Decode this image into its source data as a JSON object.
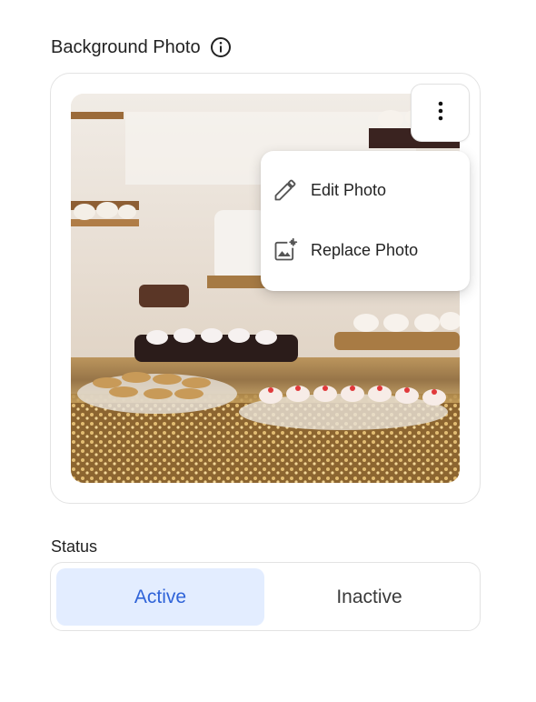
{
  "background_photo": {
    "title": "Background Photo",
    "info_icon": "info-circle-icon",
    "more_icon": "vertical-dots-icon",
    "image_description": "dessert table with cakes, cupcakes and cookies",
    "menu": {
      "items": [
        {
          "label": "Edit Photo",
          "icon": "pencil-icon"
        },
        {
          "label": "Replace Photo",
          "icon": "image-add-icon"
        }
      ]
    }
  },
  "status": {
    "label": "Status",
    "options": [
      "Active",
      "Inactive"
    ],
    "selected": "Active",
    "colors": {
      "active_bg": "#e3edff",
      "active_text": "#2f63d8",
      "inactive_text": "#3a3a3a"
    }
  }
}
